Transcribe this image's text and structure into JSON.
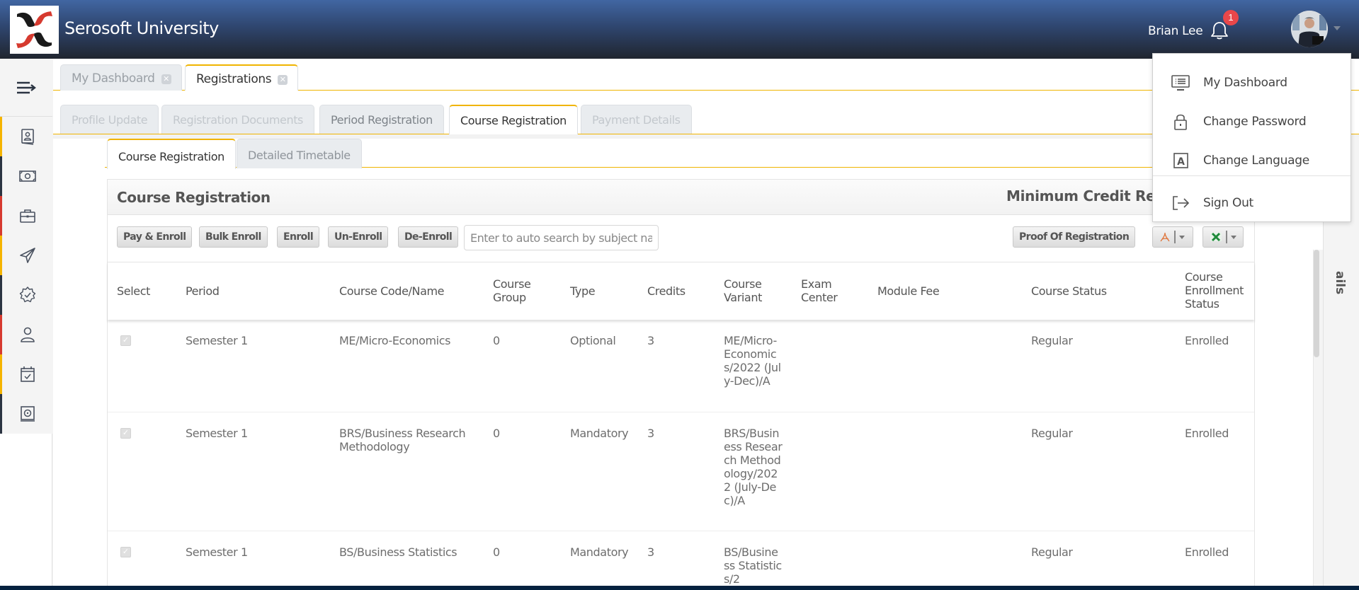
{
  "header": {
    "app_title": "Serosoft University",
    "user_name": "Brian Lee",
    "notification_count": "1",
    "colors": {
      "brand_red": "#d63a2f",
      "accent": "#f0b400",
      "badge": "#e9474a"
    }
  },
  "user_menu": {
    "items": [
      {
        "label": "My Dashboard",
        "icon": "monitor-list-icon"
      },
      {
        "label": "Change Password",
        "icon": "lock-icon"
      },
      {
        "label": "Change Language",
        "icon": "language-icon"
      },
      {
        "label": "Sign Out",
        "icon": "sign-out-icon"
      }
    ]
  },
  "sidebar": {
    "toggle_icon": "menu-arrow-icon",
    "items": [
      {
        "icon": "profile-book-icon",
        "accent": "#f5b400"
      },
      {
        "icon": "money-icon",
        "accent": "#2b3442"
      },
      {
        "icon": "briefcase-icon",
        "accent": "#d63a2f"
      },
      {
        "icon": "send-icon",
        "accent": "#f5b400"
      },
      {
        "icon": "gear-check-icon",
        "accent": "#2b3442"
      },
      {
        "icon": "user-icon",
        "accent": "#d63a2f"
      },
      {
        "icon": "calendar-check-icon",
        "accent": "#f5b400"
      },
      {
        "icon": "disc-icon",
        "accent": "#2b3442"
      }
    ]
  },
  "main_tabs": [
    {
      "label": "My Dashboard",
      "active": false
    },
    {
      "label": "Registrations",
      "active": true
    }
  ],
  "registration_steps": [
    {
      "label": "Profile Update",
      "state": "disabled"
    },
    {
      "label": "Registration Documents",
      "state": "disabled"
    },
    {
      "label": "Period Registration",
      "state": "enabled"
    },
    {
      "label": "Course Registration",
      "state": "active"
    },
    {
      "label": "Payment Details",
      "state": "disabled"
    }
  ],
  "sub_tabs": [
    {
      "label": "Course Registration",
      "active": true
    },
    {
      "label": "Detailed Timetable",
      "active": false
    }
  ],
  "panel": {
    "title": "Course Registration",
    "right_title": "Minimum Credit Requ",
    "side_panel_label": "ails"
  },
  "toolbar": {
    "buttons": [
      "Pay & Enroll",
      "Bulk Enroll",
      "Enroll",
      "Un-Enroll",
      "De-Enroll"
    ],
    "search_placeholder": "Enter to auto search by subject na",
    "proof_button": "Proof Of Registration",
    "pdf_export_icon": "pdf-icon",
    "excel_export_icon": "excel-icon"
  },
  "table": {
    "columns": [
      "Select",
      "Period",
      "Course Code/Name",
      "Course\nGroup",
      "Type",
      "Credits",
      "Course\nVariant",
      "Exam\nCenter",
      "Module Fee",
      "Course Status",
      "Course\nEnrollment\nStatus"
    ],
    "rows": [
      {
        "selected": true,
        "period": "Semester 1",
        "course": "ME/Micro-Economics",
        "group": "0",
        "type": "Optional",
        "credits": "3",
        "variant": "ME/Micro-Economics/2022 (July-Dec)/A",
        "exam_center": "",
        "module_fee": "",
        "course_status": "Regular",
        "enrollment_status": "Enrolled"
      },
      {
        "selected": true,
        "period": "Semester 1",
        "course": "BRS/Business Research Methodology",
        "group": "0",
        "type": "Mandatory",
        "credits": "3",
        "variant": "BRS/Business Research Methodology/2022 (July-Dec)/A",
        "exam_center": "",
        "module_fee": "",
        "course_status": "Regular",
        "enrollment_status": "Enrolled"
      },
      {
        "selected": true,
        "period": "Semester 1",
        "course": "BS/Business Statistics",
        "group": "0",
        "type": "Mandatory",
        "credits": "3",
        "variant": "BS/Business Statistics/2",
        "exam_center": "",
        "module_fee": "",
        "course_status": "Regular",
        "enrollment_status": "Enrolled"
      }
    ]
  }
}
